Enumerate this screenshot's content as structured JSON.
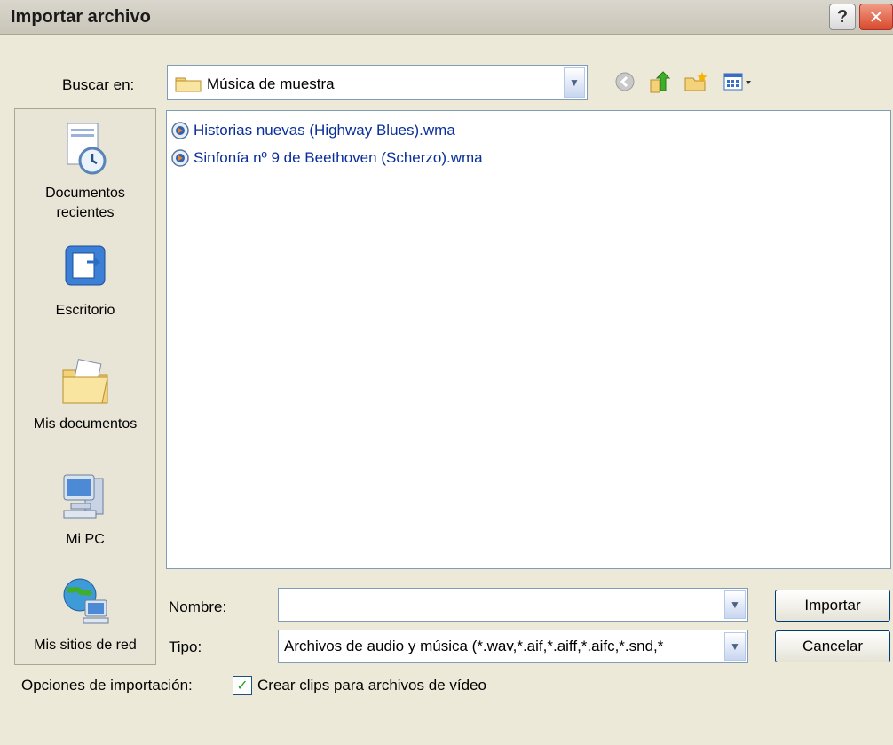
{
  "window": {
    "title": "Importar archivo",
    "help_label": "?",
    "close_label": "✕"
  },
  "lookin": {
    "label": "Buscar en:",
    "value": "Música de muestra"
  },
  "places": [
    {
      "label_line1": "Documentos",
      "label_line2": "recientes"
    },
    {
      "label_line1": "Escritorio"
    },
    {
      "label_line1": "Mis documentos"
    },
    {
      "label_line1": "Mi PC"
    },
    {
      "label_line1": "Mis sitios de red"
    }
  ],
  "files": [
    "Historias nuevas (Highway Blues).wma",
    "Sinfonía nº 9 de Beethoven (Scherzo).wma"
  ],
  "filename": {
    "label": "Nombre:",
    "value": ""
  },
  "filetype": {
    "label": "Tipo:",
    "value": "Archivos de audio y música (*.wav,*.aif,*.aiff,*.aifc,*.snd,*"
  },
  "buttons": {
    "import": "Importar",
    "cancel": "Cancelar"
  },
  "options": {
    "label": "Opciones de importación:",
    "checkbox_label": "Crear clips para archivos de vídeo",
    "checked": true
  },
  "colors": {
    "accent": "#0a2f9b",
    "close": "#d84a2c",
    "face": "#ece9d8"
  },
  "icons": [
    "help-icon",
    "close-icon",
    "folder-icon",
    "back-icon",
    "up-folder-icon",
    "new-folder-icon",
    "view-menu-icon",
    "recent-documents-icon",
    "desktop-icon",
    "my-documents-icon",
    "my-computer-icon",
    "network-places-icon",
    "audio-file-icon",
    "checkmark-icon"
  ]
}
